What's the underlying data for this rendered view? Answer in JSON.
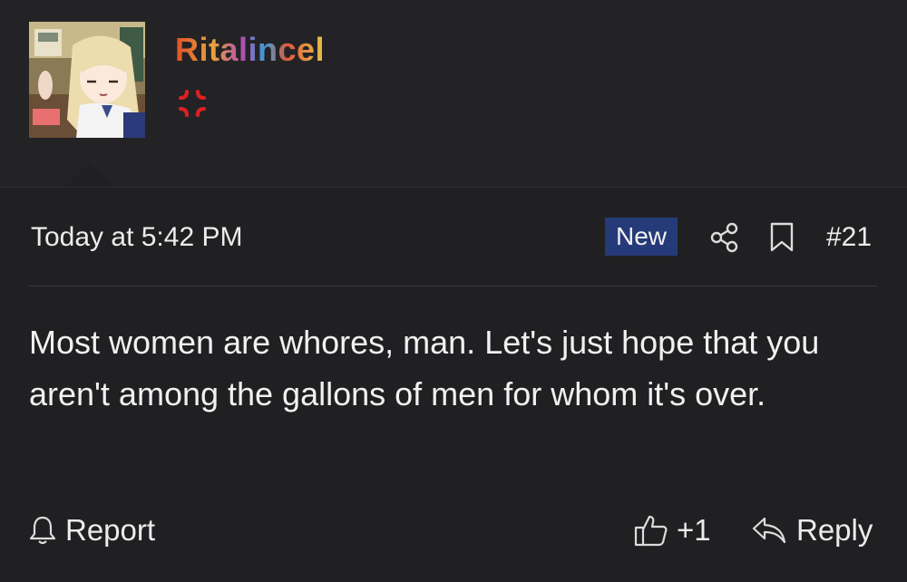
{
  "user": {
    "name": "Ritalincel",
    "avatar": "anime-girl-avatar",
    "status_icon": "anger-symbol-icon"
  },
  "post": {
    "timestamp": "Today at 5:42 PM",
    "badge": "New",
    "number": "#21",
    "message": "Most women are whores, man. Let's just hope that you aren't among the gallons of men for whom it's over."
  },
  "actions": {
    "report_label": "Report",
    "like_count": "+1",
    "reply_label": "Reply"
  },
  "colors": {
    "background": "#232325",
    "badge_bg": "#253a78",
    "status_icon": "#e02020"
  }
}
